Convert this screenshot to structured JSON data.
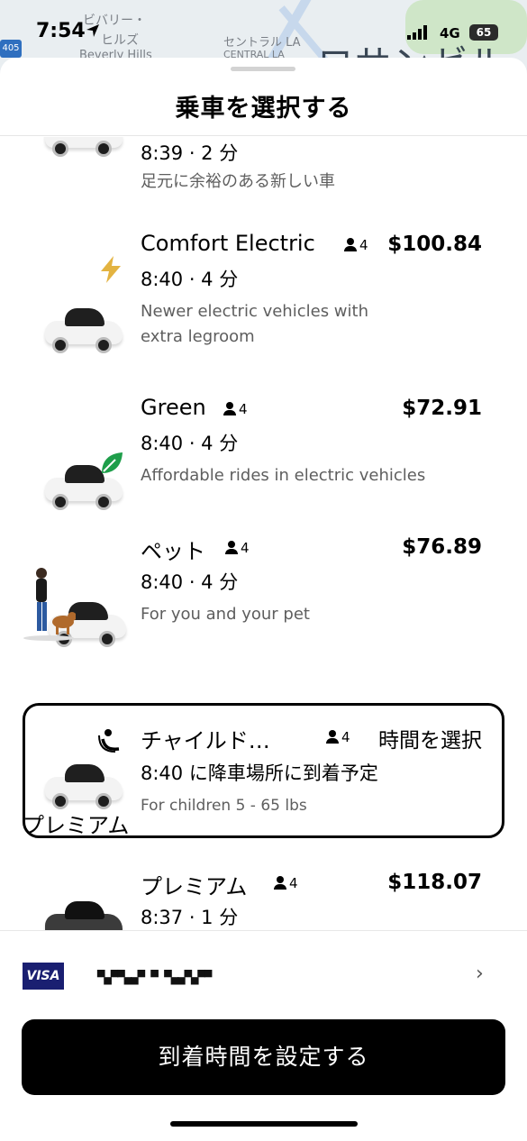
{
  "status_bar": {
    "time": "7:54",
    "network": "4G",
    "battery": "65"
  },
  "map": {
    "labels": [
      "ビバリー・",
      "ヒルズ",
      "Beverly Hills",
      "セントラル LA",
      "CENTRAL LA",
      "ロサンゼルス"
    ],
    "highway": "405"
  },
  "sheet": {
    "title": "乗車を選択する"
  },
  "rides": [
    {
      "name": "",
      "eta": "8:39 · 2 分",
      "description": "足元に余裕のある新しい車"
    },
    {
      "name": "Comfort Electric",
      "capacity": "4",
      "price": "$100.84",
      "eta": "8:40 · 4 分",
      "description": "Newer electric vehicles with extra legroom",
      "badge_icon": "lightning-icon",
      "badge_color": "#e3b341"
    },
    {
      "name": "Green",
      "capacity": "4",
      "price": "$72.91",
      "eta": "8:40 · 4 分",
      "description": "Affordable rides in electric vehicles",
      "badge_icon": "leaf-icon",
      "badge_color": "#1e9e4a"
    },
    {
      "name": "ペット",
      "capacity": "4",
      "price": "$76.89",
      "eta": "8:40 · 4 分",
      "description": "For you and your pet"
    },
    {
      "name": "チャイルド…",
      "capacity": "4",
      "price": "時間を選択",
      "eta": "8:40 に降車場所に到着予定",
      "description": "For children 5 - 65 lbs",
      "badge_icon": "child-seat-icon",
      "selected": true
    }
  ],
  "premium_section": {
    "heading": "プレミアム",
    "rides": [
      {
        "name": "プレミアム",
        "capacity": "4",
        "price": "$118.07",
        "eta": "8:37 · 1 分"
      }
    ]
  },
  "payment": {
    "card_brand": "VISA",
    "masked_number": "▀▄▀▀▄▄▀ ▀ ▀▄▄▀▄▀▀"
  },
  "cta": {
    "label": "到着時間を設定する"
  }
}
